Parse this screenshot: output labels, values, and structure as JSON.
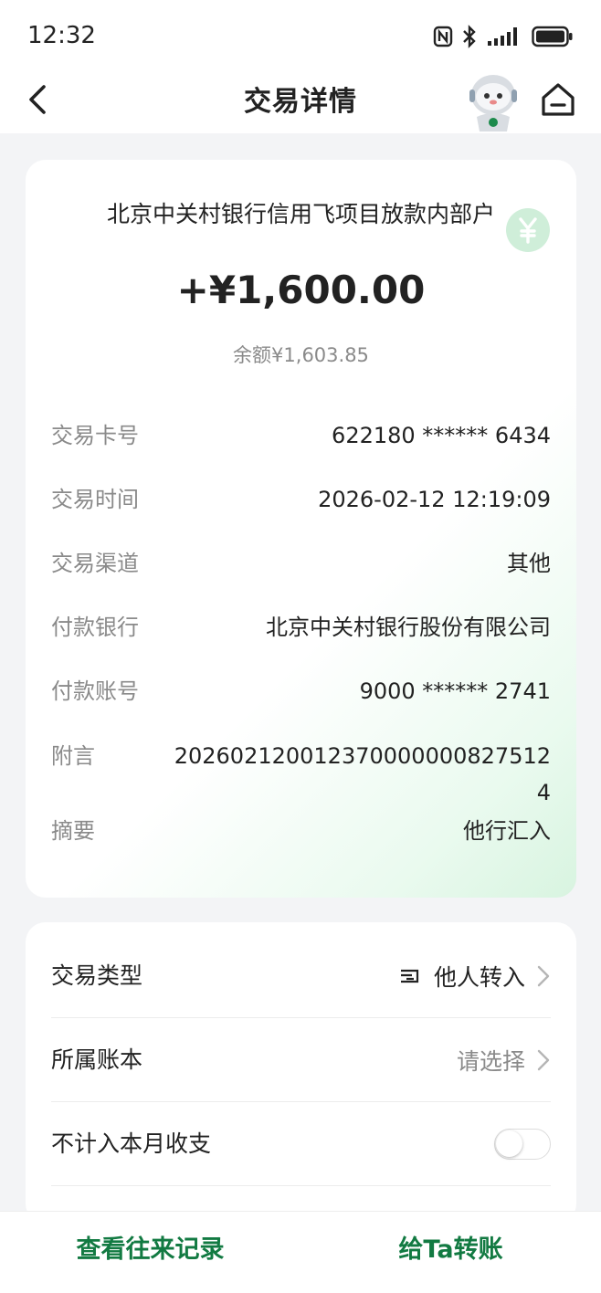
{
  "status_bar": {
    "time": "12:32",
    "icons": [
      "nfc-icon",
      "bluetooth-icon",
      "signal-icon",
      "battery-icon"
    ]
  },
  "nav": {
    "title": "交易详情",
    "back_icon": "chevron-left-icon",
    "assistant_icon": "robot-assistant-icon",
    "home_icon": "home-icon"
  },
  "transaction": {
    "payee": "北京中关村银行信用飞项目放款内部户",
    "amount": "+¥1,600.00",
    "balance": "余额¥1,603.85",
    "details": [
      {
        "label": "交易卡号",
        "value": "622180 ****** 6434"
      },
      {
        "label": "交易时间",
        "value": "2026-02-12 12:19:09"
      },
      {
        "label": "交易渠道",
        "value": "其他"
      },
      {
        "label": "付款银行",
        "value": "北京中关村银行股份有限公司"
      },
      {
        "label": "付款账号",
        "value": "9000 ****** 2741"
      },
      {
        "label": "附言",
        "value": "202602120012370000000827512\n4"
      },
      {
        "label": "摘要",
        "value": "他行汇入"
      }
    ]
  },
  "settings": {
    "type_label": "交易类型",
    "type_value": "他人转入",
    "type_icon": "transfer-card-icon",
    "book_label": "所属账本",
    "book_value": "请选择",
    "exclude_label": "不计入本月收支",
    "exclude_toggle_on": false
  },
  "bottom": {
    "history_label": "查看往来记录",
    "transfer_label": "给Ta转账"
  },
  "colors": {
    "accent_green": "#127a42",
    "muted_text": "#8a8a8a",
    "background": "#f3f4f6"
  }
}
